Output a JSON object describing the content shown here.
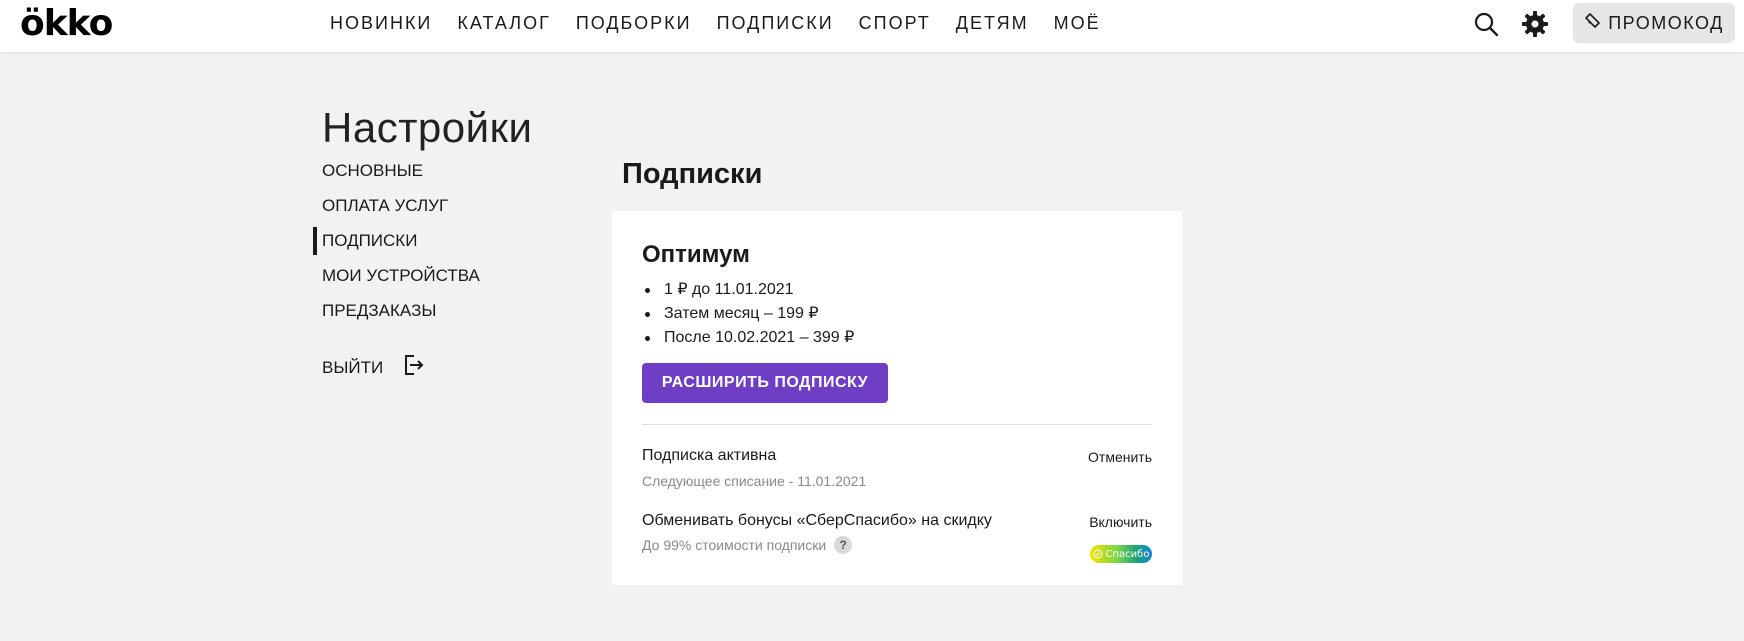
{
  "header": {
    "logo": "ökko",
    "nav": [
      "НОВИНКИ",
      "КАТАЛОГ",
      "ПОДБОРКИ",
      "ПОДПИСКИ",
      "СПОРТ",
      "ДЕТЯМ",
      "МОЁ"
    ],
    "promo_label": "ПРОМОКОД"
  },
  "settings": {
    "title": "Настройки",
    "menu": [
      "ОСНОВНЫЕ",
      "ОПЛАТА УСЛУГ",
      "ПОДПИСКИ",
      "МОИ УСТРОЙСТВА",
      "ПРЕДЗАКАЗЫ"
    ],
    "active_index": 2,
    "logout_label": "ВЫЙТИ"
  },
  "subscriptions": {
    "section_title": "Подписки",
    "plan": {
      "name": "Оптимум",
      "terms": [
        "1 ₽ до 11.01.2021",
        "Затем месяц – 199 ₽",
        "После 10.02.2021 – 399 ₽"
      ],
      "upgrade_label": "РАСШИРИТЬ ПОДПИСКУ"
    },
    "status": {
      "title": "Подписка активна",
      "subtitle": "Следующее списание - 11.01.2021",
      "action": "Отменить"
    },
    "bonus": {
      "title": "Обменивать бонусы «СберСпасибо» на скидку",
      "subtitle": "До 99% стоимости подписки",
      "help": "?",
      "action": "Включить",
      "logo_text": "Спасибо"
    }
  },
  "colors": {
    "accent": "#6e3fc4",
    "background": "#f2f2f2",
    "card": "#ffffff"
  },
  "icons": {
    "search": "search-icon",
    "settings": "gear-icon",
    "promo": "ticket-icon",
    "logout": "logout-icon"
  }
}
